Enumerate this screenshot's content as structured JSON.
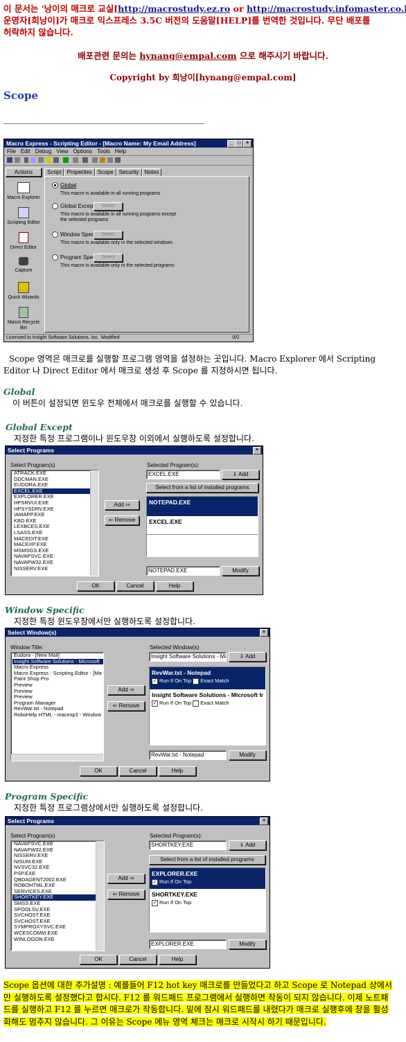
{
  "header": {
    "line1_prefix": "이 문서는 '낭이의 매크로 교실[",
    "link1": "http://macrostudy.ez.ro",
    "or": " or ",
    "link2": "http://macrostudy.infomaster.co.kr",
    "line1_suffix": "]'",
    "line2": "운영자[희낭이]가 매크로 익스프레스 3.5C 버전의 도움말[HELP]를 번역한 것입니다. 무단 배포를",
    "line3": "허락하지 않습니다.",
    "contact_prefix": "배포관련 문의는 ",
    "contact_email": "hynang@empal.com",
    "contact_suffix": " 으로 해주시기 바랍니다.",
    "copyright": "Copyright by 희낭이[hynang@empal.com]"
  },
  "page_title": "Scope",
  "editor": {
    "title": "Macro Express - Scripting Editor - [Macro Name: My Email Address]",
    "menu": [
      "File",
      "Edit",
      "Debug",
      "View",
      "Options",
      "Tools",
      "Help"
    ],
    "actions_label": "Actions",
    "tabs": [
      "Script",
      "Properties",
      "Scope",
      "Security",
      "Notes"
    ],
    "side": [
      "Macro Explorer",
      "Scripting Editor",
      "Direct Editor",
      "Capture",
      "Quick Wizards",
      "Macro Recycle Bin"
    ],
    "options": [
      {
        "label": "Global",
        "desc": "This macro is available in all running programs"
      },
      {
        "label": "Global Except",
        "desc": "This macro is available in all running programs except the selected programs"
      },
      {
        "label": "Window Specific",
        "desc": "This macro is available only in the selected windows"
      },
      {
        "label": "Program Specific",
        "desc": "This macro is available only in the selected programs"
      }
    ],
    "select_btn": "Select",
    "status": [
      "Licensed to Insight Software Solutions, Inc.",
      "Modified",
      "0/0"
    ]
  },
  "intro": "Scope 영역은 매크로를 실행할 프로그램 영역을 설정하는 곳입니다. Macro Explorer 에서 Scripting Editor 나 Direct Editor 에서 매크로 생성 후 Scope 를 지정하시면 됩니다.",
  "global": {
    "title": "Global",
    "text": "이 버튼이 설정되면 윈도우 전체에서 매크로를 실행할 수 있습니다."
  },
  "global_except": {
    "title": "Global Except",
    "text": "지정한 특정 프로그램이나 윈도우창 이외에서 실행하도록 설정합니다."
  },
  "dlg1": {
    "title": "Select Programs",
    "left_label": "Select Program(s)",
    "items": [
      "ATRACK.EXE",
      "DDCMAN.EXE",
      "EUDORA.EXE",
      "EXCEL.EXE",
      "EXPLORER.EXE",
      "HPSRVUI.EXE",
      "HPSYSDRV.EXE",
      "IAMAPP.EXE",
      "KBD.EXE",
      "LEXBCES.EXE",
      "LSASS.EXE",
      "MACEDIT.EXE",
      "MACEXP.EXE",
      "MSMSGS.EXE",
      "NAVAPSVC.EXE",
      "NAVAPW32.EXE",
      "NISSERV.EXE"
    ],
    "selected_index": 3,
    "right_label": "Selected Program(s):",
    "field": "EXCEL.EXE",
    "add": "Add",
    "add_arrow": "Add",
    "remove": "Remove",
    "installed": "Select from a list of installed programs",
    "selected": [
      "NOTEPAD.EXE",
      "EXCEL.EXE"
    ],
    "bottom_field": "NOTEPAD.EXE",
    "modify": "Modify",
    "ok": "OK",
    "cancel": "Cancel",
    "help": "Help"
  },
  "window_specific": {
    "title": "Window Specific",
    "text": "지정한 특정 윈도우창에서만 실행하도록 설정합니다."
  },
  "dlg2": {
    "title": "Select Window(s)",
    "left_label": "Window Title:",
    "items": [
      "Eudora - [New Mail]",
      "Insight Software Solutions - Microsoft",
      "Macro Express",
      "Macro Express - Scripting Editor - [Ma",
      "Paint Shop Pro",
      "Preview",
      "Preview",
      "Preview",
      "Program Manager",
      "RevWar.txt - Notepad",
      "RoboHelp HTML - macexp3 - Window"
    ],
    "selected_index": 1,
    "right_label": "Selected Window(s)",
    "field": "Insight Software Solutions - Mic",
    "add": "Add",
    "add_arrow": "Add",
    "remove": "Remove",
    "entries": [
      {
        "name": "RevWar.txt - Notepad",
        "opt1": "Run If On Top",
        "opt2": "Exact Match"
      },
      {
        "name": "Insight Software Solutions - Microsoft Ir",
        "opt1": "Run If On Top",
        "opt2": "Exact Match"
      }
    ],
    "bottom_field": "RevWar.txt - Notepad",
    "modify": "Modify",
    "ok": "OK",
    "cancel": "Cancel",
    "help": "Help"
  },
  "program_specific": {
    "title": "Program Specific",
    "text": "지정한 특정 프로그램상에서만 실행하도록 설정합니다."
  },
  "dlg3": {
    "title": "Select Programs",
    "left_label": "Select Program(s)",
    "items": [
      "NAVAPSVC.EXE",
      "NAVAPW32.EXE",
      "NISSERV.EXE",
      "NISUM.EXE",
      "NVSVC32.EXE",
      "PSP.EXE",
      "QBDAGENT2002.EXE",
      "ROBOHTML.EXE",
      "SERVICES.EXE",
      "SHORTKEY.EXE",
      "SMSS.EXE",
      "SPOOLSV.EXE",
      "SVCHOST.EXE",
      "SVCHOST.EXE",
      "SYMPROXYSVC.EXE",
      "WCESCOMM.EXE",
      "WINLOGON.EXE"
    ],
    "selected_index": 9,
    "right_label": "Selected Program(s):",
    "field": "SHORTKEY.EXE",
    "add": "Add",
    "add_arrow": "Add",
    "remove": "Remove",
    "installed": "Select from a list of installed programs",
    "entries": [
      {
        "name": "EXPLORER.EXE",
        "opt": "Run If On Top"
      },
      {
        "name": "SHORTKEY.EXE",
        "opt": "Run If On Top"
      }
    ],
    "bottom_field": "EXPLORER.EXE",
    "modify": "Modify",
    "ok": "OK",
    "cancel": "Cancel",
    "help": "Help"
  },
  "note": "Scope 옵션에 대한 추가설명 : 예를들어 F12 hot key 매크로를 만들었다고 하고 Scope 로 Notepad 상에서만 실행하도록 설정했다고 합시다. F12 를 워드패드 프로그램에서 실행하면 작동이 되지 않습니다. 이제 노트패드를 실행하고 F12 를 누르면 매크로가 작동합니다. 밑에 잠시 워드패드를 내렸다가 매크로 실행후에 창을 활성화해도 멈추지 않습니다. 그 이유는 Scope 메뉴 영역 체크는 매크로 시작시 하기 때문입니다."
}
